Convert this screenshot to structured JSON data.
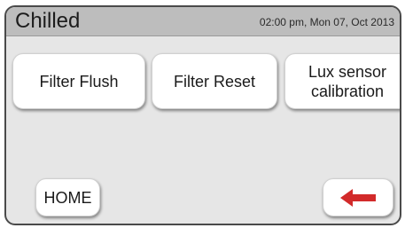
{
  "header": {
    "title": "Chilled",
    "datetime": "02:00 pm, Mon 07, Oct 2013"
  },
  "buttons": {
    "filter_flush": "Filter Flush",
    "filter_reset": "Filter Reset",
    "lux_calibration": "Lux sensor\ncalibration",
    "home": "HOME"
  },
  "icons": {
    "back": "left-arrow-icon"
  },
  "colors": {
    "header_bg": "#bdbdbd",
    "panel_bg": "#e6e6e6",
    "arrow": "#d22a2a"
  }
}
